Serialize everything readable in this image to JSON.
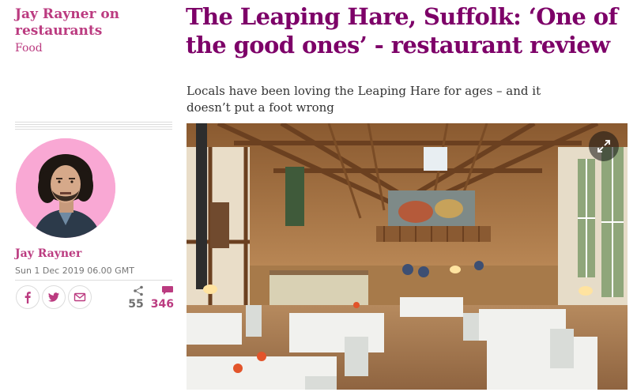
{
  "series": {
    "title": "Jay Rayner on restaurants",
    "section": "Food"
  },
  "headline": "The Leaping Hare, Suffolk: ‘One of the good ones’ - restaurant review",
  "standfirst": "Locals have been loving the Leaping Hare for ages – and it doesn’t put a foot wrong",
  "byline": {
    "author": "Jay Rayner",
    "date": "Sun 1 Dec 2019 06.00 GMT"
  },
  "share": {
    "facebook_icon": "facebook-icon",
    "twitter_icon": "twitter-icon",
    "email_icon": "email-icon"
  },
  "counts": {
    "shares": "55",
    "comments": "346"
  },
  "colors": {
    "accent": "#bb3b80",
    "headline": "#7d0068",
    "avatar_bg": "#f9a8d4"
  },
  "hero": {
    "expand_icon": "expand-icon"
  }
}
